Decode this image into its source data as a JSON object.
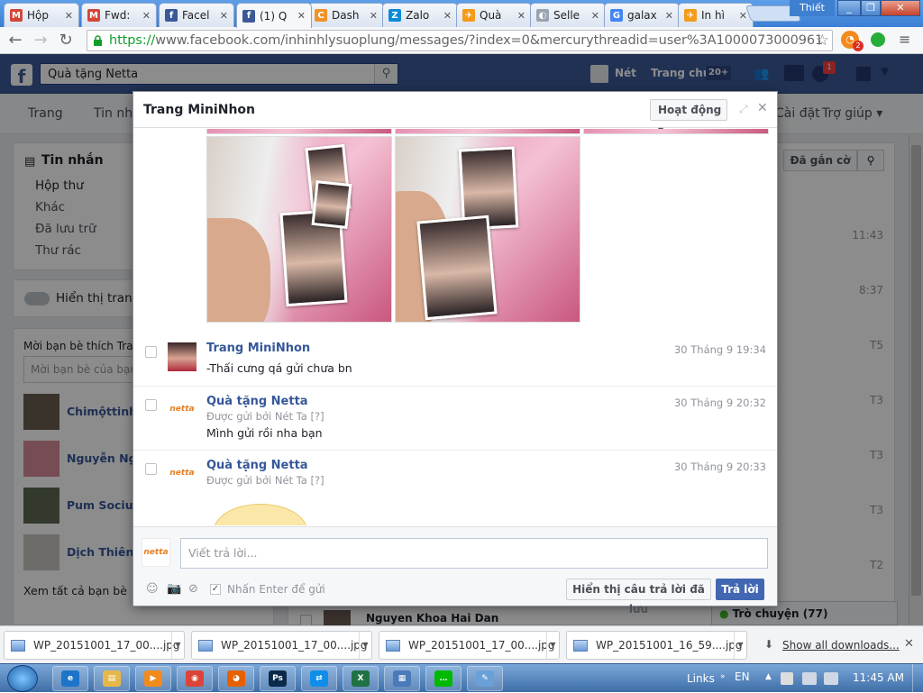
{
  "browser": {
    "tabs": [
      {
        "label": "Hộp",
        "icon": "gmail-icon",
        "color": "#d44638",
        "glyph": "M"
      },
      {
        "label": "Fwd:",
        "icon": "gmail-icon",
        "color": "#d44638",
        "glyph": "M"
      },
      {
        "label": "Facel",
        "icon": "facebook-icon",
        "color": "#3b5998",
        "glyph": "f"
      },
      {
        "label": "(1) Q",
        "icon": "facebook-icon",
        "color": "#3b5998",
        "glyph": "f",
        "active": true
      },
      {
        "label": "Dash",
        "icon": "dashboard-icon",
        "color": "#f0932b",
        "glyph": "C"
      },
      {
        "label": "Zalo",
        "icon": "zalo-icon",
        "color": "#0a8ad8",
        "glyph": "Z"
      },
      {
        "label": "Quà",
        "icon": "alibaba-icon",
        "color": "#f49b1a",
        "glyph": "✈"
      },
      {
        "label": "Selle",
        "icon": "seller-icon",
        "color": "#9aa4b1",
        "glyph": "◐"
      },
      {
        "label": "galax",
        "icon": "google-icon",
        "color": "#4285f4",
        "glyph": "G"
      },
      {
        "label": "In hì",
        "icon": "alibaba-icon",
        "color": "#f49b1a",
        "glyph": "✈"
      }
    ],
    "window_user": "Thiết",
    "url_secure": "https://",
    "url_rest": "www.facebook.com/inhinhlysuoplung/messages/?index=0&mercurythreadid=user%3A1000073000961"
  },
  "fb": {
    "search_value": "Quà tặng Netta",
    "header_name": "Nét",
    "header_home": "Trang chủ",
    "header_home_badge": "20+",
    "notif_badge": "1",
    "subnav": [
      "Trang",
      "Tin nhắ",
      "Cài đặt",
      "Trợ giúp ▾"
    ],
    "inbox_title": "Tin nhắn",
    "folders": [
      "Hộp thư",
      "Khác",
      "Đã lưu trữ",
      "Thư rác"
    ],
    "show_page_toggle": "Hiển thị trang",
    "invite_title": "Mời bạn bè thích Trang",
    "invite_placeholder": "Mời bạn bè của bạn",
    "friends": [
      "Chimộttinhyê",
      "Nguyễn Ngâ",
      "Pum Sociu",
      "Dịch Thiên Tì"
    ],
    "see_all_friends": "Xem tất cả bạn bè",
    "flagged_btn": "Đã gắn cờ",
    "right_times": [
      "11:43",
      "8:37",
      "T5",
      "T3",
      "T3",
      "T3",
      "T2"
    ],
    "bottom_contact": "Nguyen Khoa Hai Dan",
    "chat_label": "Trò chuyện (77)"
  },
  "dialog": {
    "title": "Trang MiniNhon",
    "activity_btn": "Hoạt động ▾",
    "messages": [
      {
        "name": "Trang MiniNhon",
        "sub": "",
        "text": "-Thấi cưng qá gửi chưa bn",
        "time": "30 Tháng 9 19:34"
      },
      {
        "name": "Quà tặng Netta",
        "sub": "Được gửi bởi Nét Ta",
        "sub_q": "[?]",
        "text": "Mình gửi rồi nha bạn",
        "time": "30 Tháng 9 20:32"
      },
      {
        "name": "Quà tặng Netta",
        "sub": "Được gửi bởi Nét Ta",
        "sub_q": "[?]",
        "text": "",
        "time": "30 Tháng 9 20:33"
      }
    ],
    "netta_logo_text": "netta",
    "reply_placeholder": "Viết trả lời...",
    "enter_to_send": "Nhấn Enter để gửi",
    "show_saved_btn": "Hiển thị câu trả lời đã lưu",
    "reply_btn": "Trả lời"
  },
  "downloads": {
    "items": [
      "WP_20151001_17_00....jpg",
      "WP_20151001_17_00....jpg",
      "WP_20151001_17_00....jpg",
      "WP_20151001_16_59....jpg"
    ],
    "show_all": "Show all downloads..."
  },
  "taskbar": {
    "apps": [
      {
        "icon": "internet-explorer-icon",
        "color": "#1e74c8",
        "glyph": "e"
      },
      {
        "icon": "file-explorer-icon",
        "color": "#e6b84a",
        "glyph": "▤"
      },
      {
        "icon": "media-player-icon",
        "color": "#f28a1c",
        "glyph": "▶"
      },
      {
        "icon": "chrome-icon",
        "color": "#db4437",
        "glyph": "◉"
      },
      {
        "icon": "firefox-icon",
        "color": "#e66000",
        "glyph": "◕"
      },
      {
        "icon": "photoshop-icon",
        "color": "#0b2a4a",
        "glyph": "Ps"
      },
      {
        "icon": "teamviewer-icon",
        "color": "#0e8ee9",
        "glyph": "⇄"
      },
      {
        "icon": "excel-icon",
        "color": "#1f7244",
        "glyph": "X"
      },
      {
        "icon": "network-icon",
        "color": "#4a7ab8",
        "glyph": "▦"
      },
      {
        "icon": "line-icon",
        "color": "#00b900",
        "glyph": "…"
      },
      {
        "icon": "paint-icon",
        "color": "#6aa0d8",
        "glyph": "✎"
      }
    ],
    "links": "Links",
    "lang": "EN",
    "clock": "11:45 AM"
  }
}
